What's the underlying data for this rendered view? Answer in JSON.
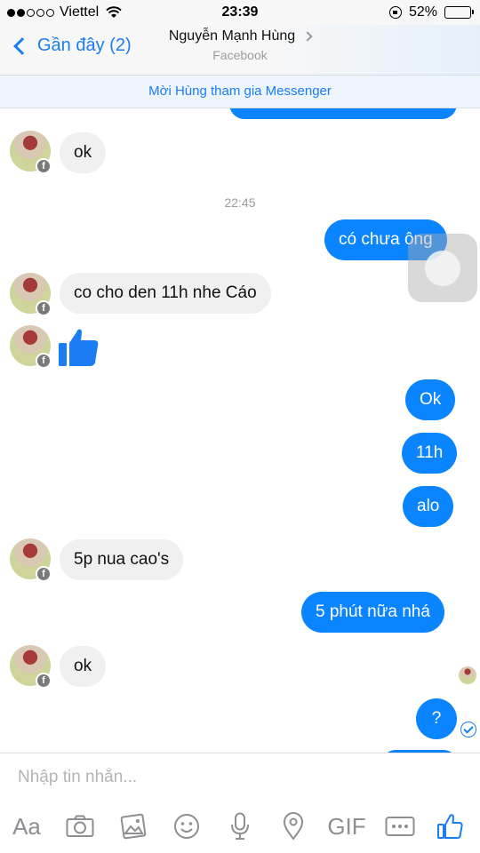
{
  "status_bar": {
    "carrier": "Viettel",
    "time": "23:39",
    "battery": "52%",
    "battery_level": 0.52,
    "signal_dots_filled": 2,
    "signal_dots_total": 5
  },
  "nav": {
    "back_label": "Gần đây (2)",
    "title": "Nguyễn Mạnh Hùng",
    "subtitle": "Facebook"
  },
  "banner": {
    "invite_text": "Mời Hùng tham gia Messenger"
  },
  "messages": {
    "m1": "ok",
    "timestamp": "22:45",
    "m2": "có chưa ông",
    "m3": "co cho den 11h nhe Cáo",
    "m4": "Ok",
    "m5": "11h",
    "m6": "alo",
    "m7": "5p nua cao's",
    "m8": "5 phút nữa nhá",
    "m9": "ok",
    "m10": "?"
  },
  "composer": {
    "placeholder": "Nhập tin nhắn...",
    "gif_label": "GIF",
    "text_label": "Aa"
  },
  "icons": {
    "accent": "#1a7df3",
    "bubble_out": "#0a84ff",
    "bubble_in": "#f0f0f0",
    "toolbar": [
      "text-format-icon",
      "camera-icon",
      "gallery-icon",
      "emoji-icon",
      "microphone-icon",
      "location-icon",
      "gif-icon",
      "more-icon",
      "like-icon"
    ]
  }
}
